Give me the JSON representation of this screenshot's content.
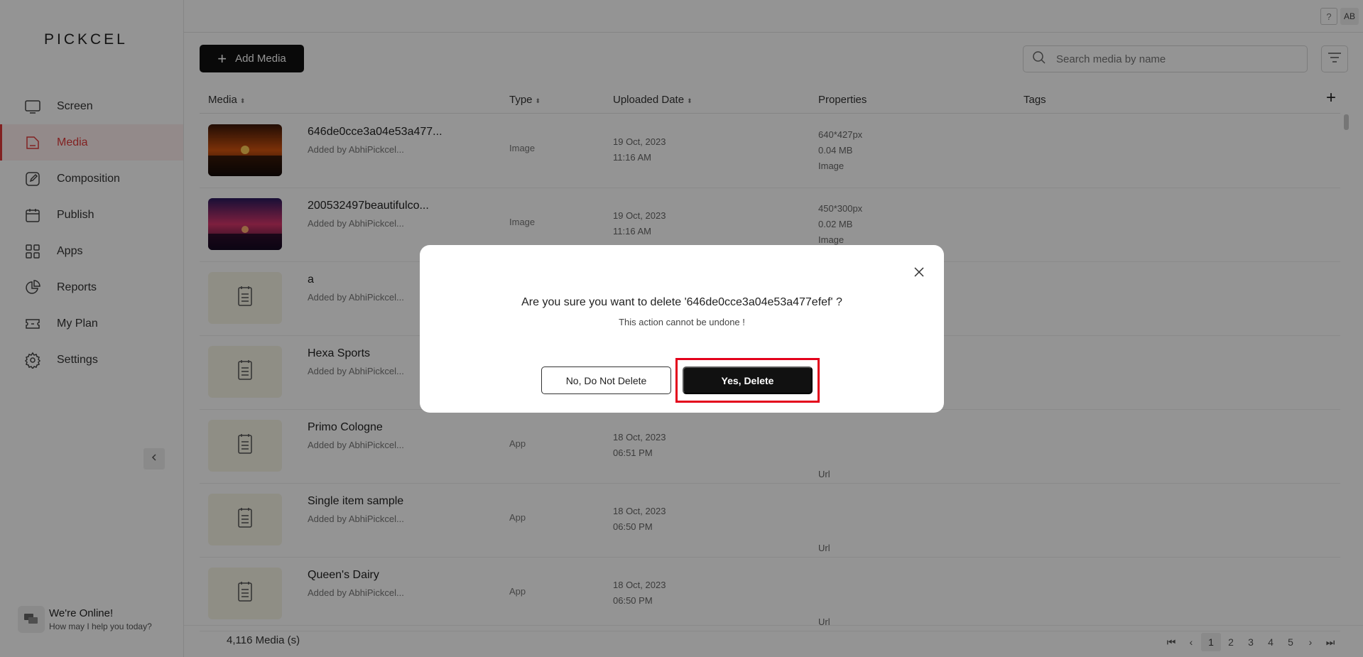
{
  "logo": "PICKCEL",
  "sidebar": {
    "items": [
      {
        "label": "Screen",
        "icon": "monitor-icon"
      },
      {
        "label": "Media",
        "icon": "media-folder-icon",
        "active": true
      },
      {
        "label": "Composition",
        "icon": "edit-icon"
      },
      {
        "label": "Publish",
        "icon": "calendar-icon"
      },
      {
        "label": "Apps",
        "icon": "apps-grid-icon"
      },
      {
        "label": "Reports",
        "icon": "pie-chart-icon"
      },
      {
        "label": "My Plan",
        "icon": "ticket-icon"
      },
      {
        "label": "Settings",
        "icon": "gear-icon"
      }
    ],
    "chat_title": "We're Online!",
    "chat_subtitle": "How may I help you today?"
  },
  "topbar": {
    "help": "?",
    "avatar": "AB"
  },
  "toolbar": {
    "add_media_label": "Add Media",
    "search_placeholder": "Search media by name"
  },
  "table": {
    "headers": {
      "media": "Media",
      "type": "Type",
      "uploaded": "Uploaded Date",
      "properties": "Properties",
      "tags": "Tags"
    },
    "rows": [
      {
        "name": "646de0cce3a04e53a477...",
        "added": "Added by AbhiPickcel...",
        "type": "Image",
        "date": "19 Oct, 2023",
        "time": "11:16 AM",
        "p1": "640*427px",
        "p2": "0.04 MB",
        "p3": "Image",
        "thumb": "sunset"
      },
      {
        "name": "200532497beautifulco...",
        "added": "Added by AbhiPickcel...",
        "type": "Image",
        "date": "19 Oct, 2023",
        "time": "11:16 AM",
        "p1": "450*300px",
        "p2": "0.02 MB",
        "p3": "Image",
        "thumb": "purple"
      },
      {
        "name": "a",
        "added": "Added by AbhiPickcel...",
        "type": "",
        "date": "",
        "time": "",
        "p1": "",
        "p2": "",
        "p3": "",
        "thumb": "app"
      },
      {
        "name": "Hexa Sports",
        "added": "Added by AbhiPickcel...",
        "type": "",
        "date": "",
        "time": "",
        "p1": "",
        "p2": "",
        "p3": "",
        "thumb": "app"
      },
      {
        "name": "Primo Cologne",
        "added": "Added by AbhiPickcel...",
        "type": "App",
        "date": "18 Oct, 2023",
        "time": "06:51 PM",
        "p1": "Url",
        "p2": "",
        "p3": "",
        "thumb": "app"
      },
      {
        "name": "Single item sample",
        "added": "Added by AbhiPickcel...",
        "type": "App",
        "date": "18 Oct, 2023",
        "time": "06:50 PM",
        "p1": "Url",
        "p2": "",
        "p3": "",
        "thumb": "app"
      },
      {
        "name": "Queen's Dairy",
        "added": "Added by AbhiPickcel...",
        "type": "App",
        "date": "18 Oct, 2023",
        "time": "06:50 PM",
        "p1": "Url",
        "p2": "",
        "p3": "",
        "thumb": "app"
      }
    ]
  },
  "footer": {
    "count": "4,116 Media (s)",
    "pages": [
      "1",
      "2",
      "3",
      "4",
      "5"
    ],
    "current_page": "1"
  },
  "dialog": {
    "question": "Are you sure you want to delete '646de0cce3a04e53a477efef' ?",
    "warning": "This action cannot be undone !",
    "cancel_label": "No, Do Not Delete",
    "confirm_label": "Yes, Delete"
  },
  "colors": {
    "accent": "#e03a3a",
    "primary_button": "#111111",
    "highlight": "#e3001b"
  }
}
